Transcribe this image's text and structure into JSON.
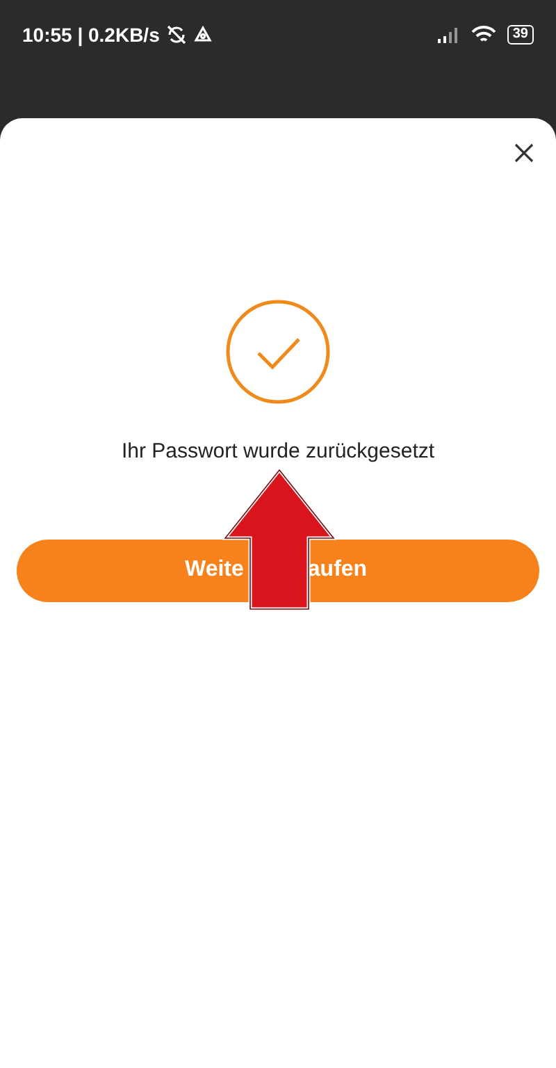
{
  "status_bar": {
    "time": "10:55 | 0.2KB/s",
    "battery": "39"
  },
  "dialog": {
    "message": "Ihr Passwort wurde zurückgesetzt",
    "button": {
      "label_parts": [
        "Weite",
        "aufen"
      ]
    }
  }
}
